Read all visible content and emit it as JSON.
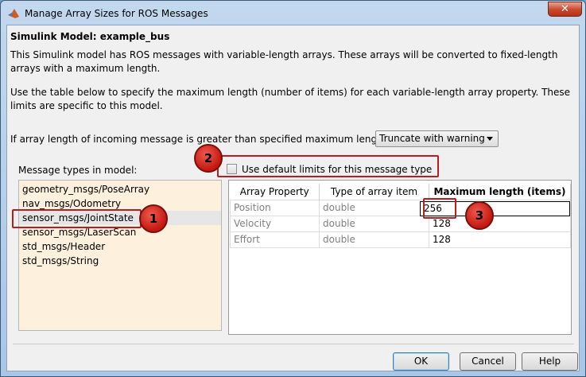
{
  "window": {
    "title": "Manage Array Sizes for ROS Messages",
    "close_label": "✕"
  },
  "content": {
    "model_title": "Simulink Model: example_bus",
    "paragraph1": "This Simulink model has ROS messages with variable-length arrays. These arrays will be converted to fixed-length arrays with a maximum length.",
    "paragraph2": "Use the table below to specify the maximum length (number of items) for each variable-length array property. These limits are specific to this model.",
    "truncate_label": "If array length of incoming message is greater than specified maximum length:",
    "truncate_value": "Truncate with warning"
  },
  "messages": {
    "label": "Message types in model:",
    "items": [
      "geometry_msgs/PoseArray",
      "nav_msgs/Odometry",
      "sensor_msgs/JointState",
      "sensor_msgs/LaserScan",
      "std_msgs/Header",
      "std_msgs/String"
    ]
  },
  "default_limits": {
    "label": "Use default limits for this message type",
    "checked": false
  },
  "table": {
    "headers": [
      "Array Property",
      "Type of array item",
      "Maximum length (items)"
    ],
    "rows": [
      [
        "Position",
        "double",
        "256"
      ],
      [
        "Velocity",
        "double",
        "128"
      ],
      [
        "Effort",
        "double",
        "128"
      ]
    ]
  },
  "buttons": {
    "ok": "OK",
    "cancel": "Cancel",
    "help": "Help"
  },
  "callouts": [
    "1",
    "2",
    "3"
  ],
  "colors": {
    "callout": "#b81d22",
    "list_background": "#fdf0dc"
  }
}
